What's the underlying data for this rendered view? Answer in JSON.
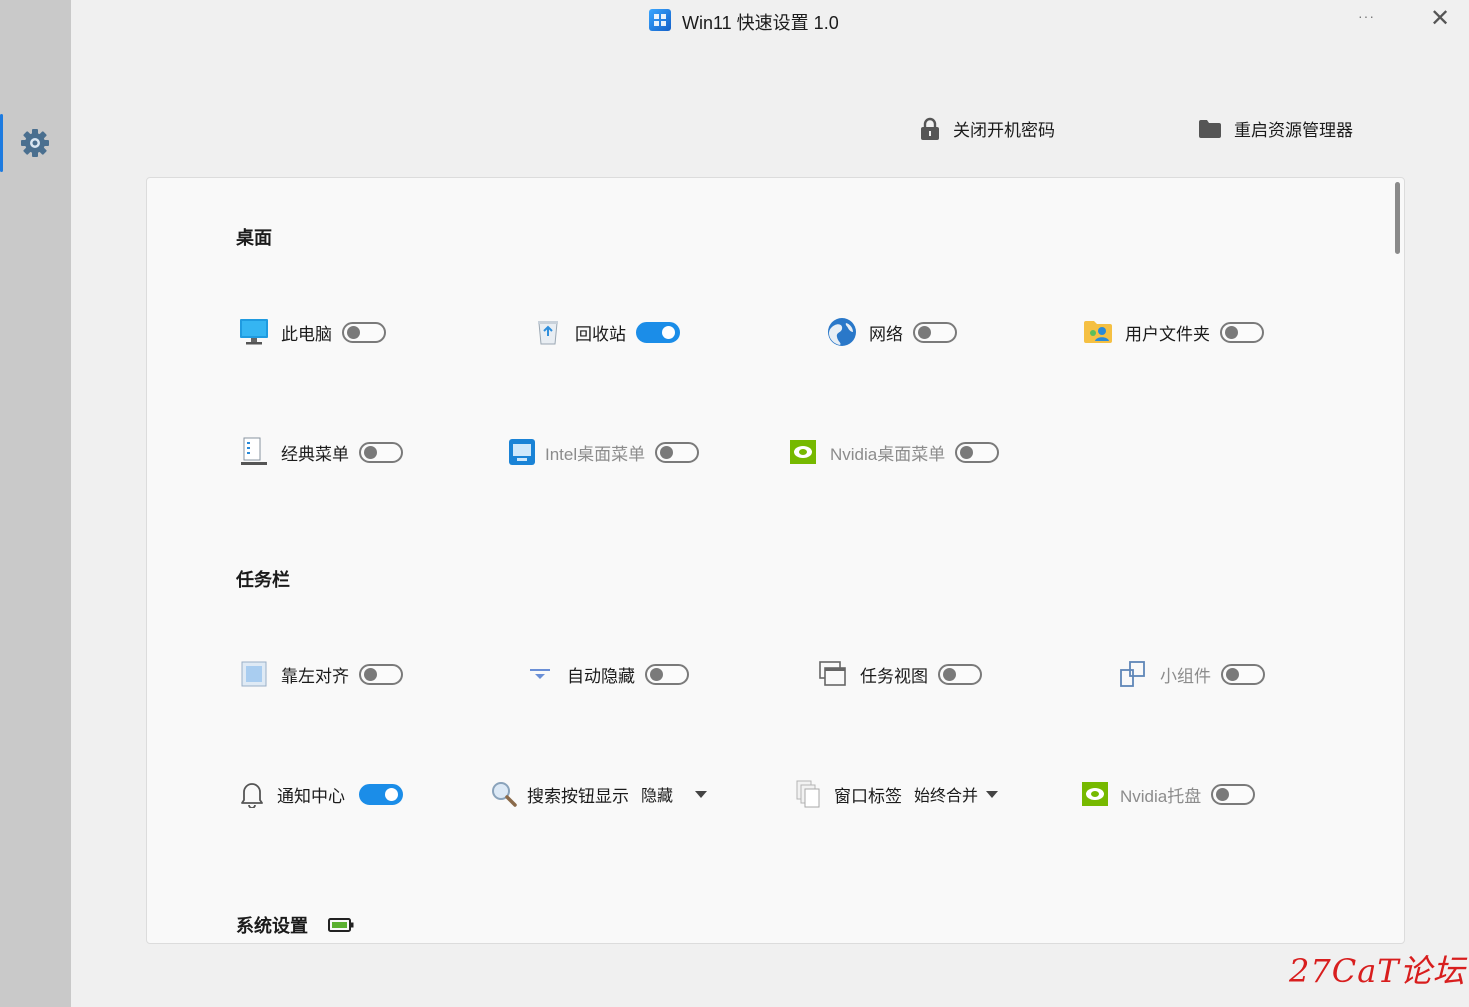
{
  "window": {
    "title": "Win11 快速设置 1.0",
    "more_label": "···",
    "close_label": "✕"
  },
  "sidebar": {
    "icon": "gear-icon",
    "accent": "#1d7be0"
  },
  "top_actions": [
    {
      "label": "关闭开机密码",
      "icon": "lock-icon"
    },
    {
      "label": "重启资源管理器",
      "icon": "folder-icon"
    }
  ],
  "sections": {
    "desktop": {
      "title": "桌面",
      "items": [
        {
          "label": "此电脑",
          "icon": "monitor-icon",
          "toggle": false
        },
        {
          "label": "回收站",
          "icon": "recycle-bin-icon",
          "toggle": true
        },
        {
          "label": "网络",
          "icon": "globe-icon",
          "toggle": false
        },
        {
          "label": "用户文件夹",
          "icon": "user-folder-icon",
          "toggle": false
        },
        {
          "label": "经典菜单",
          "icon": "classic-menu-icon",
          "toggle": false
        },
        {
          "label": "Intel桌面菜单",
          "icon": "intel-icon",
          "toggle": false
        },
        {
          "label": "Nvidia桌面菜单",
          "icon": "nvidia-icon",
          "toggle": false
        }
      ]
    },
    "taskbar": {
      "title": "任务栏",
      "items": [
        {
          "label": "靠左对齐",
          "icon": "align-left-icon",
          "toggle": false
        },
        {
          "label": "自动隐藏",
          "icon": "autohide-icon",
          "toggle": false
        },
        {
          "label": "任务视图",
          "icon": "task-view-icon",
          "toggle": false
        },
        {
          "label": "小组件",
          "icon": "widgets-icon",
          "toggle": false
        },
        {
          "label": "通知中心",
          "icon": "bell-icon",
          "toggle": true
        },
        {
          "label": "搜索按钮显示",
          "icon": "search-icon",
          "value": "隐藏"
        },
        {
          "label": "窗口标签",
          "icon": "window-tabs-icon",
          "value": "始终合并"
        },
        {
          "label": "Nvidia托盘",
          "icon": "nvidia-icon",
          "toggle": false
        }
      ]
    },
    "system": {
      "title": "系统设置",
      "icon": "battery-icon"
    }
  },
  "watermark": "27CaT论坛",
  "colors": {
    "toggle_on": "#1b8de8",
    "toggle_off": "#7a7a7a",
    "panel_bg": "#f9f9f9",
    "sidebar_bg": "#c9c9c9"
  }
}
